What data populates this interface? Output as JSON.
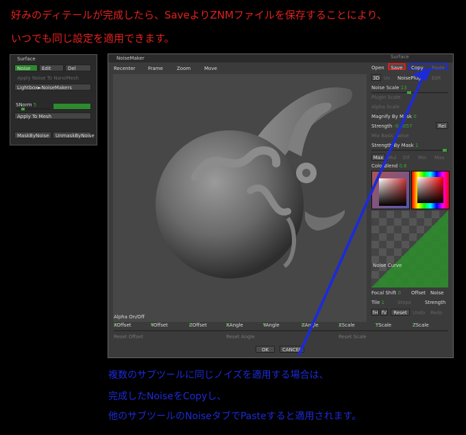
{
  "notes": {
    "top_line1": "好みのディテールが完成したら、SaveよりZNMファイルを保存することにより、",
    "top_line2": "いつでも同じ設定を適用できます。",
    "bottom_line1": "複数のサブツールに同じノイズを適用する場合は、",
    "bottom_line2": "完成したNoiseをCopyし、",
    "bottom_line3": "他のサブツールのNoiseタブでPasteすると適用されます。"
  },
  "surface_panel": {
    "title": "Surface",
    "noise": "Noise",
    "edit": "Edit",
    "del": "Del",
    "apply_nanomesh": "Apply Noise To NanoMesh",
    "lightbox": "Lightbox►NoiseMakers",
    "snorm_label": "SNorm",
    "snorm_value": "5",
    "apply_mesh": "Apply To Mesh",
    "mask_by_noise": "MaskByNoise",
    "unmask_by_noise": "UnmaskByNoise"
  },
  "noisemaker": {
    "title": "NoiseMaker",
    "toolbar": [
      "Recenter",
      "Frame",
      "Zoom",
      "Move"
    ],
    "alpha_onoff": "Alpha On/Off",
    "ok": "OK",
    "cancel": "CANCEL"
  },
  "right_panel": {
    "surface": "Surface",
    "open": "Open",
    "save": "Save",
    "copy": "Copy",
    "paste": "Paste",
    "tab_3d": "3D",
    "tab_uv": "Uv",
    "noiseplug": "NoisePlug",
    "edit": "Edit",
    "noise_scale_label": "Noise Scale",
    "noise_scale_value": "13",
    "plugin_scale": "Plugin Scale",
    "alpha_scale": "Alpha Scale",
    "magnify_label": "Magnify By Mask",
    "magnify_value": "0",
    "strength_label": "Strength",
    "strength_value": "-0.0057",
    "rel": "Rel",
    "mix_basic": "Mix Basic Noise",
    "strength_mask_label": "Strength By Mask",
    "strength_mask_value": "1",
    "blend_modes": [
      "Max",
      "Mul",
      "Dif",
      "Min",
      "Max"
    ],
    "colorblend_label": "ColorBlend",
    "colorblend_value": "0.6",
    "noise_curve": "Noise Curve",
    "focal_shift_label": "Focal Shift",
    "focal_shift_value": "0",
    "offset": "Offset",
    "noise": "Noise",
    "tile_label": "Tile",
    "tile_value": "1",
    "steps": "Steps",
    "strength2": "Strength",
    "fh": "fH",
    "fv": "fV",
    "reset": "Reset",
    "undo": "Undo",
    "redo": "Redo"
  },
  "bottom_sliders": [
    {
      "label": "XOffset",
      "value": "0"
    },
    {
      "label": "YOffset",
      "value": "0"
    },
    {
      "label": "ZOffset",
      "value": "0"
    },
    {
      "label": "XAngle",
      "value": "0"
    },
    {
      "label": "YAngle",
      "value": "0"
    },
    {
      "label": "ZAngle",
      "value": "0"
    },
    {
      "label": "XScale",
      "value": "1"
    },
    {
      "label": "YScale",
      "value": "1"
    },
    {
      "label": "ZScale",
      "value": "1"
    }
  ],
  "reset_buttons": [
    "Reset Offset",
    "Reset Angle",
    "Reset Scale"
  ],
  "colors": {
    "red_text": "#e5201e",
    "blue_text": "#1d2bd6",
    "highlight_red": "#e01b1b",
    "highlight_blue": "#1d2bd6",
    "active_green": "#2d8a2d"
  }
}
